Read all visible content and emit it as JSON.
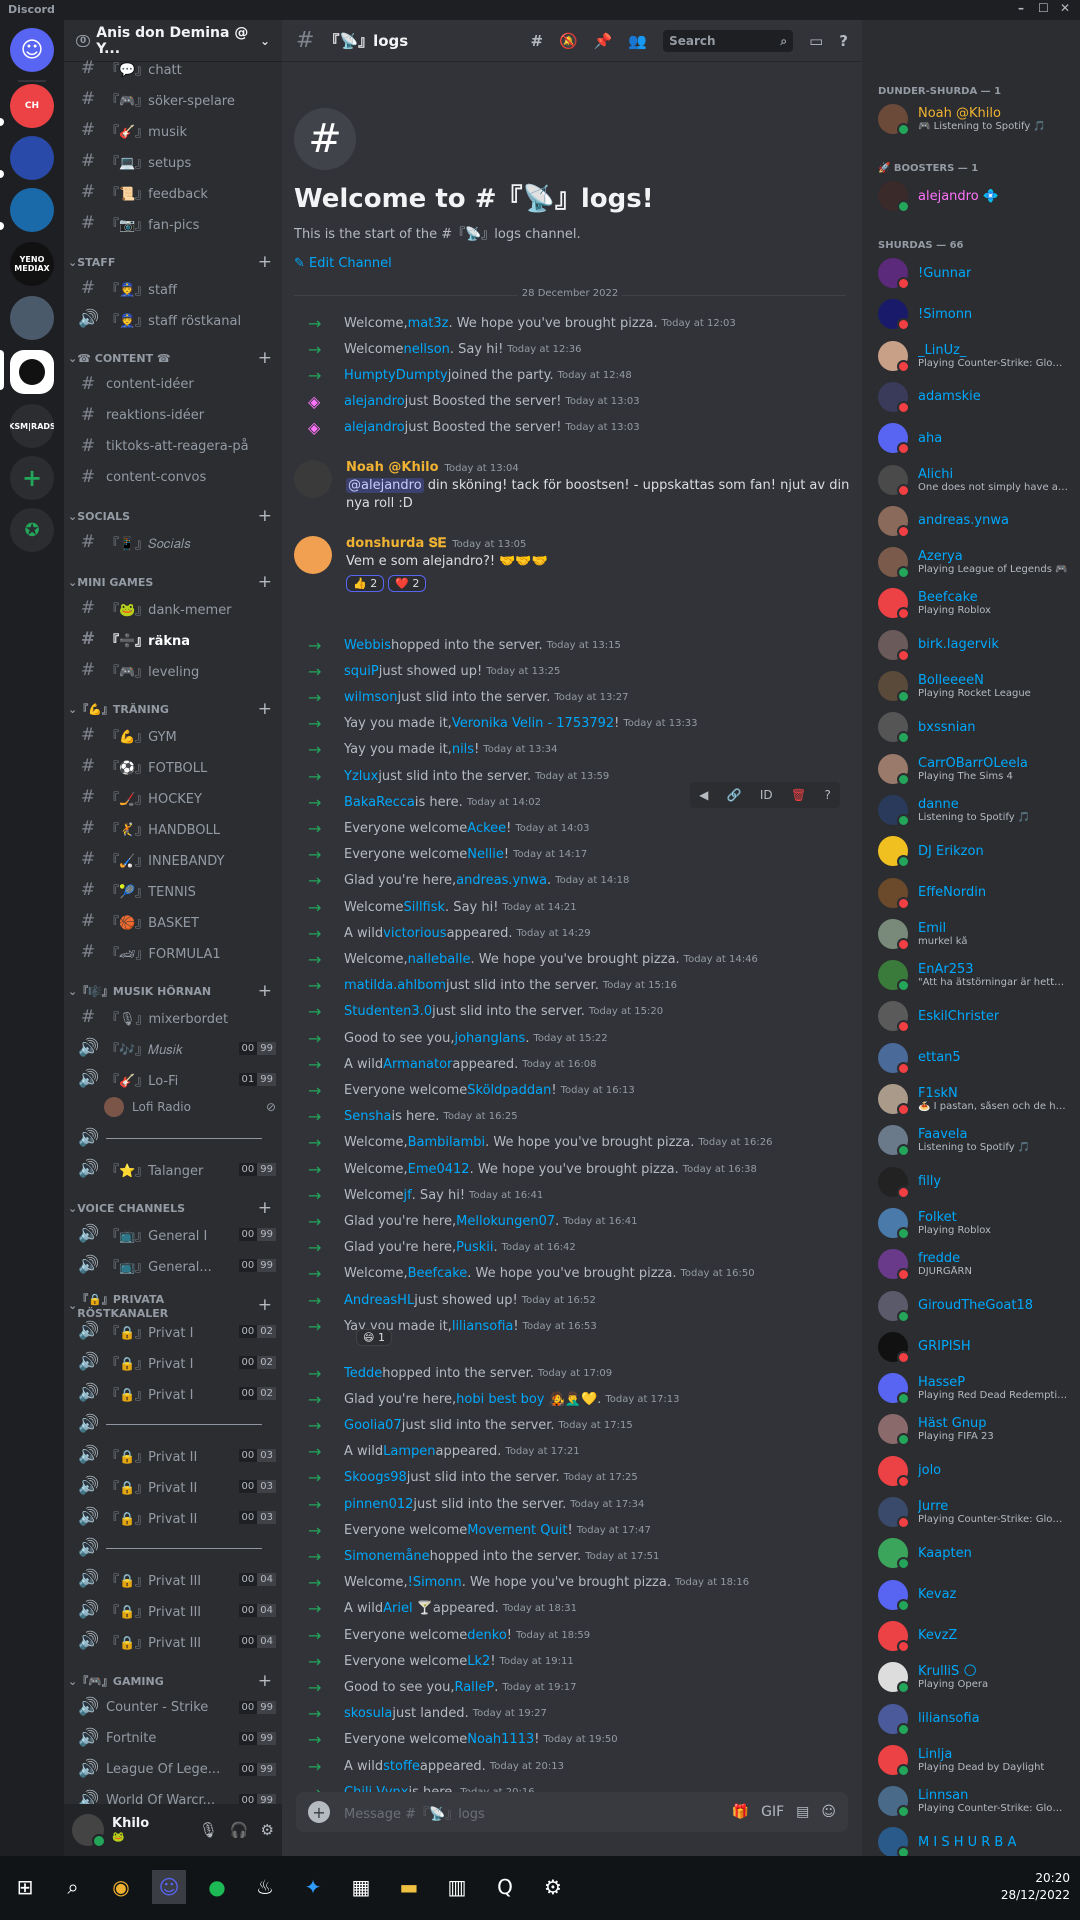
{
  "titlebar": {
    "app": "Discord"
  },
  "server": {
    "name": "Anis don Demina @ Y...",
    "badge": "0"
  },
  "guilds": [
    {
      "label": ""
    },
    {
      "label": "CH"
    },
    {
      "label": ""
    },
    {
      "label": ""
    },
    {
      "label": "YENO MEDIAX"
    },
    {
      "label": ""
    },
    {
      "label": ""
    },
    {
      "label": "KSM|RADS"
    }
  ],
  "channels": [
    {
      "type": "text",
      "name": "『💬』chatt"
    },
    {
      "type": "text",
      "name": "『🎮』söker-spelare"
    },
    {
      "type": "text",
      "name": "『🎸』musik"
    },
    {
      "type": "text",
      "name": "『💻』setups"
    },
    {
      "type": "text",
      "name": "『📜』feedback"
    },
    {
      "type": "text",
      "name": "『📷』fan-pics"
    }
  ],
  "categories": {
    "staff": "STAFF",
    "content": "☎ CONTENT ☎",
    "socials": "SOCIALS",
    "minigames": "MINI GAMES",
    "traning": "『💪』TRÄNING",
    "musik": "『🎼』MUSIK HÖRNAN",
    "voice": "VOICE CHANNELS",
    "privata": "『🔒』PRIVATA RÖSTKANALER",
    "gaming": "『🎮』GAMING"
  },
  "staff_channels": [
    "『👮』staff",
    "『👮』staff röstkanal"
  ],
  "content_channels": [
    "content-idéer",
    "reaktions-idéer",
    "tiktoks-att-reagera-på",
    "content-convos"
  ],
  "socials_channels": [
    "『📱』𝑆𝑜𝑐𝑖𝑎𝑙𝑠"
  ],
  "minigame_channels": [
    "『🐸』dank-memer",
    "『➗』räkna",
    "『🎮』leveling"
  ],
  "traning_channels": [
    "『💪』GYM",
    "『⚽』FOTBOLL",
    "『🏒』HOCKEY",
    "『🤾』HANDBOLL",
    "『🏑』INNEBANDY",
    "『🎾』TENNIS",
    "『🏀』BASKET",
    "『🏎』FORMULA1"
  ],
  "musik_channels": {
    "mixer": "『🎙』mixerbordet",
    "musik": "『🎶』𝑀𝑢𝑠𝑖𝑘",
    "musik_c": [
      "00",
      "99"
    ],
    "lofi": "『🎸』Lo-Fi",
    "lofi_c": [
      "01",
      "99"
    ],
    "lofi_user": "Lofi Radio",
    "sep": "――――――――――――",
    "talanger": "『⭐』Talanger",
    "talanger_c": [
      "00",
      "99"
    ]
  },
  "voice_channels": [
    {
      "name": "『📺』General I",
      "c": [
        "00",
        "99"
      ]
    },
    {
      "name": "『📺』General...",
      "c": [
        "00",
        "99"
      ]
    }
  ],
  "private_channels": [
    {
      "name": "『🔒』Privat I",
      "c": [
        "00",
        "02"
      ]
    },
    {
      "name": "『🔒』Privat I",
      "c": [
        "00",
        "02"
      ]
    },
    {
      "name": "『🔒』Privat I",
      "c": [
        "00",
        "02"
      ]
    },
    {
      "name": "――――――――――――",
      "c": null
    },
    {
      "name": "『🔒』Privat II",
      "c": [
        "00",
        "03"
      ]
    },
    {
      "name": "『🔒』Privat II",
      "c": [
        "00",
        "03"
      ]
    },
    {
      "name": "『🔒』Privat II",
      "c": [
        "00",
        "03"
      ]
    },
    {
      "name": "――――――――――――",
      "c": null
    },
    {
      "name": "『🔒』Privat III",
      "c": [
        "00",
        "04"
      ]
    },
    {
      "name": "『🔒』Privat III",
      "c": [
        "00",
        "04"
      ]
    },
    {
      "name": "『🔒』Privat III",
      "c": [
        "00",
        "04"
      ]
    }
  ],
  "gaming_channels": [
    {
      "name": "Counter - Strike",
      "c": [
        "00",
        "99"
      ]
    },
    {
      "name": "Fortnite",
      "c": [
        "00",
        "99"
      ]
    },
    {
      "name": "League Of Lege...",
      "c": [
        "00",
        "99"
      ]
    },
    {
      "name": "World Of Warcr...",
      "c": [
        "00",
        "99"
      ]
    }
  ],
  "user": {
    "name": "Khilo",
    "status": "🐸"
  },
  "header": {
    "channel": "『📡』logs",
    "search": "Search"
  },
  "welcome": {
    "title": "Welcome to #『📡』logs!",
    "sub": "This is the start of the #『📡』logs channel.",
    "edit": "✎ Edit Channel"
  },
  "date_divider": "28 December 2022",
  "sys_top": [
    {
      "pre": "Welcome, ",
      "u": "mat3z",
      "post": ". We hope you've brought pizza.",
      "ts": "Today at 12:03",
      "boost": false
    },
    {
      "pre": "Welcome ",
      "u": "nellson",
      "post": ". Say hi!",
      "ts": "Today at 12:36",
      "boost": false
    },
    {
      "pre": "",
      "u": "HumptyDumpty",
      "post": " joined the party.",
      "ts": "Today at 12:48",
      "boost": false
    },
    {
      "pre": "",
      "u": "alejandro",
      "post": " just Boosted the server!",
      "ts": "Today at 13:03",
      "boost": true
    },
    {
      "pre": "",
      "u": "alejandro",
      "post": " just Boosted the server!",
      "ts": "Today at 13:03",
      "boost": true
    }
  ],
  "msg1": {
    "name": "Noah @Khilo",
    "ts": "Today at 13:04",
    "mention": "@alejandro",
    "text": " din sköning! tack för boostsen! - uppskattas som fan! njut av din nya roll :D"
  },
  "msg2": {
    "name": "donshurda 𝐒𝐄",
    "ts": "Today at 13:05",
    "text": "Vem e som alejandro?! 🤝🤝🤝",
    "r1": "👍 2",
    "r2": "❤️ 2"
  },
  "sys_bottom": [
    {
      "pre": "",
      "u": "Webbis",
      "post": " hopped into the server.",
      "ts": "Today at 13:15"
    },
    {
      "pre": "",
      "u": "squiP",
      "post": " just showed up!",
      "ts": "Today at 13:25"
    },
    {
      "pre": "",
      "u": "wilmson",
      "post": " just slid into the server.",
      "ts": "Today at 13:27"
    },
    {
      "pre": "Yay you made it, ",
      "u": "Veronika Velin - 1753792",
      "post": "!",
      "ts": "Today at 13:33"
    },
    {
      "pre": "Yay you made it, ",
      "u": "nils",
      "post": "!",
      "ts": "Today at 13:34"
    },
    {
      "pre": "",
      "u": "Yzlux",
      "post": " just slid into the server.",
      "ts": "Today at 13:59"
    },
    {
      "pre": "",
      "u": "BakaRecca",
      "post": " is here.",
      "ts": "Today at 14:02"
    },
    {
      "pre": "Everyone welcome ",
      "u": "Ackee",
      "post": "!",
      "ts": "Today at 14:03"
    },
    {
      "pre": "Everyone welcome ",
      "u": "Nellie",
      "post": "!",
      "ts": "Today at 14:17"
    },
    {
      "pre": "Glad you're here, ",
      "u": "andreas.ynwa",
      "post": ".",
      "ts": "Today at 14:18"
    },
    {
      "pre": "Welcome ",
      "u": "Sillfisk",
      "post": ". Say hi!",
      "ts": "Today at 14:21"
    },
    {
      "pre": "A wild ",
      "u": "victorious",
      "post": " appeared.",
      "ts": "Today at 14:29"
    },
    {
      "pre": "Welcome, ",
      "u": "nalleballe",
      "post": ". We hope you've brought pizza.",
      "ts": "Today at 14:46"
    },
    {
      "pre": "",
      "u": "matilda.ahlbom",
      "post": " just slid into the server.",
      "ts": "Today at 15:16"
    },
    {
      "pre": "",
      "u": "Studenten3.0",
      "post": " just slid into the server.",
      "ts": "Today at 15:20"
    },
    {
      "pre": "Good to see you, ",
      "u": "johanglans",
      "post": ".",
      "ts": "Today at 15:22"
    },
    {
      "pre": "A wild ",
      "u": "Armanator",
      "post": " appeared.",
      "ts": "Today at 16:08"
    },
    {
      "pre": "Everyone welcome ",
      "u": "Sköldpaddan",
      "post": "!",
      "ts": "Today at 16:13"
    },
    {
      "pre": "",
      "u": "Sensha",
      "post": " is here.",
      "ts": "Today at 16:25"
    },
    {
      "pre": "Welcome, ",
      "u": "Bambilambi",
      "post": ". We hope you've brought pizza.",
      "ts": "Today at 16:26"
    },
    {
      "pre": "Welcome, ",
      "u": "Eme0412",
      "post": ". We hope you've brought pizza.",
      "ts": "Today at 16:38"
    },
    {
      "pre": "Welcome ",
      "u": "jf",
      "post": ". Say hi!",
      "ts": "Today at 16:41"
    },
    {
      "pre": "Glad you're here, ",
      "u": "Mellokungen07",
      "post": ".",
      "ts": "Today at 16:41"
    },
    {
      "pre": "Glad you're here, ",
      "u": "Puskii",
      "post": ".",
      "ts": "Today at 16:42"
    },
    {
      "pre": "Welcome, ",
      "u": "Beefcake",
      "post": ". We hope you've brought pizza.",
      "ts": "Today at 16:50"
    },
    {
      "pre": "",
      "u": "AndreasHL",
      "post": " just showed up!",
      "ts": "Today at 16:52"
    },
    {
      "pre": "Yay you made it, ",
      "u": "liliansofia",
      "post": "!",
      "ts": "Today at 16:53"
    }
  ],
  "reaction_smile": "😄 1",
  "sys_bottom2": [
    {
      "pre": "",
      "u": "Tedde",
      "post": " hopped into the server.",
      "ts": "Today at 17:09"
    },
    {
      "pre": "Glad you're here, ",
      "u": "hobi best boy 🧑‍🎤🤦‍♂️💛",
      "post": ".",
      "ts": "Today at 17:13"
    },
    {
      "pre": "",
      "u": "Goolia07",
      "post": " just slid into the server.",
      "ts": "Today at 17:15"
    },
    {
      "pre": "A wild ",
      "u": "Lampen",
      "post": " appeared.",
      "ts": "Today at 17:21"
    },
    {
      "pre": "",
      "u": "Skoogs98",
      "post": " just slid into the server.",
      "ts": "Today at 17:25"
    },
    {
      "pre": "",
      "u": "pinnen012",
      "post": " just slid into the server.",
      "ts": "Today at 17:34"
    },
    {
      "pre": "Everyone welcome ",
      "u": "Movement Quit",
      "post": "!",
      "ts": "Today at 17:47"
    },
    {
      "pre": "",
      "u": "Simonemåne",
      "post": " hopped into the server.",
      "ts": "Today at 17:51"
    },
    {
      "pre": "Welcome, ",
      "u": "!Simonn",
      "post": ". We hope you've brought pizza.",
      "ts": "Today at 18:16"
    },
    {
      "pre": "A wild ",
      "u": "Ariel 🍸",
      "post": " appeared.",
      "ts": "Today at 18:31"
    },
    {
      "pre": "Everyone welcome ",
      "u": "denko",
      "post": "!",
      "ts": "Today at 18:59"
    },
    {
      "pre": "Everyone welcome ",
      "u": "Lk2",
      "post": "!",
      "ts": "Today at 19:11"
    },
    {
      "pre": "Good to see you, ",
      "u": "RalleP",
      "post": ".",
      "ts": "Today at 19:17"
    },
    {
      "pre": "",
      "u": "skosula",
      "post": " just landed.",
      "ts": "Today at 19:27"
    },
    {
      "pre": "Everyone welcome ",
      "u": "Noah1113",
      "post": "!",
      "ts": "Today at 19:50"
    },
    {
      "pre": "A wild ",
      "u": "stoffe",
      "post": " appeared.",
      "ts": "Today at 20:13"
    },
    {
      "pre": "",
      "u": "Chili Vynx",
      "post": " is here.",
      "ts": "Today at 20:16"
    }
  ],
  "input": {
    "placeholder": "Message #『📡』logs"
  },
  "members": {
    "cat1": "DUNDER-SHURDA — 1",
    "cat2": "🚀 BOOSTERS — 1",
    "cat3": "SHURDAS — 66",
    "top": [
      {
        "name": "Noah @Khilo",
        "act": "🎮 Listening to Spotify 🎵",
        "cls": "gold",
        "c": "#6b4a3a",
        "on": true
      },
      {
        "name": "alejandro 💠",
        "act": "",
        "cls": "pink",
        "c": "#3a2a2a",
        "on": true
      }
    ],
    "list": [
      {
        "name": "!Gunnar",
        "act": "",
        "c": "#5b2a7a",
        "on": false
      },
      {
        "name": "!Simonn",
        "act": "",
        "c": "#1a1a6a",
        "on": false
      },
      {
        "name": "_LinUz_",
        "act": "Playing Counter-Strike: Globa...",
        "c": "#c8a088",
        "on": false
      },
      {
        "name": "adamskie",
        "act": "",
        "c": "#3a3a5a",
        "on": false
      },
      {
        "name": "aha",
        "act": "",
        "c": "#5865f2",
        "on": false
      },
      {
        "name": "Alichi",
        "act": "One does not simply have a go...",
        "c": "#4a4a4a",
        "on": false
      },
      {
        "name": "andreas.ynwa",
        "act": "",
        "c": "#8a6a5a",
        "on": false
      },
      {
        "name": "Azerya",
        "act": "Playing League of Legends 🎮",
        "c": "#7a5a4a",
        "on": true
      },
      {
        "name": "Beefcake",
        "act": "Playing Roblox",
        "c": "#ed4245",
        "on": false
      },
      {
        "name": "birk.lagervik",
        "act": "",
        "c": "#6a5a5a",
        "on": false
      },
      {
        "name": "BolleeeeN",
        "act": "Playing Rocket League",
        "c": "#5a4a3a",
        "on": true
      },
      {
        "name": "bxssnian",
        "act": "",
        "c": "#555",
        "on": true
      },
      {
        "name": "CarrOBarrOLeela",
        "act": "Playing The Sims 4",
        "c": "#9a7a6a",
        "on": true
      },
      {
        "name": "danne",
        "act": "Listening to Spotify 🎵",
        "c": "#2a3a5a",
        "on": true
      },
      {
        "name": "DJ Erikzon",
        "act": "",
        "c": "#f0c020",
        "on": true
      },
      {
        "name": "EffeNordin",
        "act": "",
        "c": "#6a4a2a",
        "on": false
      },
      {
        "name": "Emil",
        "act": "murkel kå",
        "c": "#7a8a7a",
        "on": false
      },
      {
        "name": "EnAr253",
        "act": "\"Att ha ätstörningar är hett\" R...",
        "c": "#3a7a3a",
        "on": true
      },
      {
        "name": "EskilChrister",
        "act": "",
        "c": "#5a5a5a",
        "on": false
      },
      {
        "name": "ettan5",
        "act": "",
        "c": "#4a6a9a",
        "on": false
      },
      {
        "name": "F1skN",
        "act": "🍝 I pastan, såsen och de heli...",
        "c": "#aa9a8a",
        "on": false
      },
      {
        "name": "Faavela",
        "act": "Listening to Spotify 🎵",
        "c": "#6a7a8a",
        "on": true
      },
      {
        "name": "filly",
        "act": "",
        "c": "#222",
        "on": false
      },
      {
        "name": "Folket",
        "act": "Playing Roblox",
        "c": "#4a7aaa",
        "on": true
      },
      {
        "name": "fredde",
        "act": "DJURGÅRN",
        "c": "#6a3a8a",
        "on": false
      },
      {
        "name": "GiroudTheGoat18",
        "act": "",
        "c": "#5a5a6a",
        "on": true
      },
      {
        "name": "GRIPISH",
        "act": "",
        "c": "#111",
        "on": false
      },
      {
        "name": "HasseP",
        "act": "Playing Red Dead Redemptio...",
        "c": "#5865f2",
        "on": true
      },
      {
        "name": "Häst Gnup",
        "act": "Playing FIFA 23",
        "c": "#8a6a6a",
        "on": true
      },
      {
        "name": "jolo",
        "act": "",
        "c": "#ed4245",
        "on": false
      },
      {
        "name": "Jurre",
        "act": "Playing Counter-Strike: Globa...",
        "c": "#3a4a6a",
        "on": false
      },
      {
        "name": "Kaapten",
        "act": "",
        "c": "#3ba55c",
        "on": true
      },
      {
        "name": "Kevaz",
        "act": "",
        "c": "#5865f2",
        "on": true
      },
      {
        "name": "KevzZ",
        "act": "",
        "c": "#ed4245",
        "on": false
      },
      {
        "name": "KrulliS 🌕",
        "act": "Playing Opera",
        "c": "#ddd",
        "on": true
      },
      {
        "name": "liliansofia",
        "act": "",
        "c": "#4a5a9a",
        "on": true
      },
      {
        "name": "Linlja",
        "act": "Playing Dead by Daylight",
        "c": "#ed4245",
        "on": true
      },
      {
        "name": "Linnsan",
        "act": "Playing Counter-Strike: Globa...",
        "c": "#4a6a8a",
        "on": true
      },
      {
        "name": "M I S H U R B A",
        "act": "",
        "c": "#2a5a8a",
        "on": true
      }
    ]
  },
  "taskbar": {
    "time": "20:20",
    "date": "28/12/2022"
  }
}
